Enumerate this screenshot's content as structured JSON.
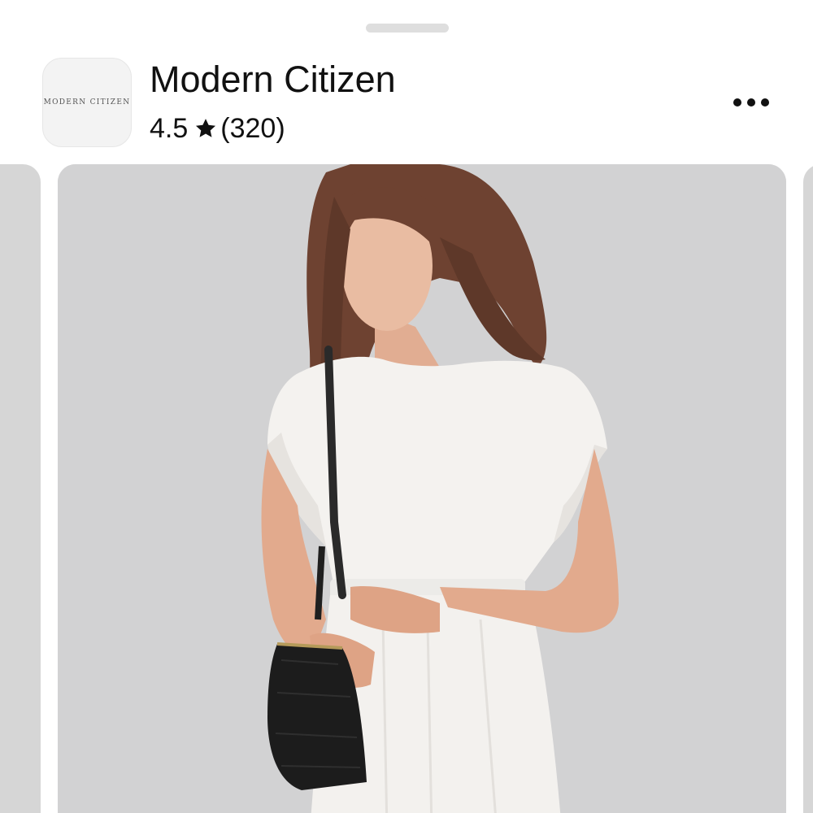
{
  "sheet": {
    "drag_handle": "drag-handle"
  },
  "store": {
    "logo_text": "MODERN CITIZEN",
    "name": "Modern Citizen",
    "rating": "4.5",
    "review_count": "(320)",
    "star_icon": "star-icon",
    "more_icon": "more-horizontal-icon"
  },
  "carousel": {
    "current_image": "product-photo-white-dress",
    "background_color": "#d2d2d3"
  }
}
